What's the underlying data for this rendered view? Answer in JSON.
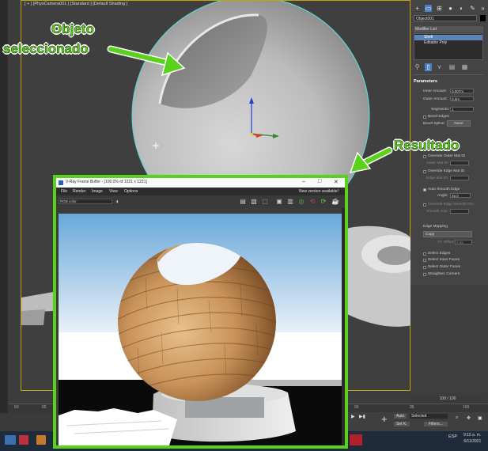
{
  "viewport": {
    "label": "[ + ] [PhysCamera001 ] [Standard ] [Default Shading ]"
  },
  "command_panel": {
    "object_name": "Object001",
    "modifier_list_label": "Modifier List",
    "stack": [
      "Shell",
      "Editable Poly"
    ],
    "rollout_title": "Parameters",
    "inner_amount_label": "Inner Amount:",
    "inner_amount_value": "0,007m",
    "outer_amount_label": "Outer Amount:",
    "outer_amount_value": "0,0m",
    "segments_label": "Segments:",
    "segments_value": "1",
    "bevel_edges_label": "Bevel Edges",
    "bevel_spline_label": "Bevel Spline:",
    "bevel_spline_value": "None",
    "override_outer_label": "Override Outer Mat ID",
    "outer_mat_id_label": "Outer Mat ID:",
    "override_edge_label": "Override Edge Mat ID",
    "edge_mat_id_label": "Edge Mat ID:",
    "auto_smooth_label": "Auto Smooth Edge",
    "angle_label": "Angle:",
    "angle_value": "45,0",
    "override_smooth_label": "Override Edge Smooth Gro",
    "smooth_grp_label": "Smooth Grp:",
    "edge_mapping_label": "Edge Mapping",
    "edge_mapping_value": "Copy",
    "tv_offset_label": "TV Offset:",
    "tv_offset_value": "0,05",
    "select_edges_label": "Select Edges",
    "select_inner_label": "Select Inner Faces",
    "select_outer_label": "Select Outer Faces",
    "straighten_label": "Straighten Corners"
  },
  "timeline": {
    "frame_counter": "100 / 100",
    "ticks": [
      "60",
      "65",
      "70",
      "75",
      "80",
      "85",
      "90",
      "95",
      "100"
    ]
  },
  "bottom": {
    "auto_label": "Auto",
    "selected_value": "Selected",
    "setk_label": "Set K.",
    "filters_label": "Filters..."
  },
  "taskbar": {
    "lang": "ESP",
    "time": "9:15 a. m.",
    "date": "6/11/2021"
  },
  "vfb": {
    "title": "V-Ray Frame Buffer - [100.0% of 1221 x 1221]",
    "menus": [
      "File",
      "Render",
      "Image",
      "View",
      "Options"
    ],
    "new_version": "New version available!",
    "channel": "RGB color"
  },
  "annotations": {
    "object_line1": "Objeto",
    "object_line2": "seleccionado",
    "result": "Resultado"
  },
  "colors": {
    "annotation_green": "#5ad11a",
    "viewport_border": "#c9a200",
    "shell_highlight": "#5d84b8"
  }
}
